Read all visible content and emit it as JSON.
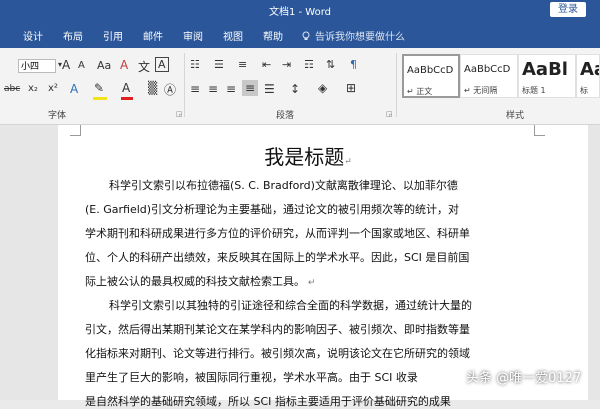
{
  "window": {
    "title": "文档1 - Word",
    "login": "登录"
  },
  "ribbon_tabs": [
    "设计",
    "布局",
    "引用",
    "邮件",
    "审阅",
    "视图",
    "帮助"
  ],
  "tell_me": "告诉我你想要做什么",
  "font": {
    "size": "小四",
    "grow": "A",
    "shrink": "A",
    "aa": "Aa",
    "clear": "A",
    "wen": "文",
    "box_a": "A"
  },
  "format_row": {
    "abc": "abc",
    "sub": "x₂",
    "sup": "x²",
    "effect": "A",
    "font_color": "A"
  },
  "groups": {
    "font": "字体",
    "paragraph": "段落",
    "styles": "样式"
  },
  "styles": [
    {
      "sample": "AaBbCcD",
      "name": "↵ 正文"
    },
    {
      "sample": "AaBbCcD",
      "name": "↵ 无间隔"
    },
    {
      "sample": "AaBl",
      "name": "标题 1"
    },
    {
      "sample": "Aa",
      "name": "标"
    }
  ],
  "document": {
    "title": "我是标题",
    "para1": [
      "科学引文索引以布拉德福(S. C. Bradford)文献离散律理论、以加菲尔德",
      "(E. Garfield)引文分析理论为主要基础，通过论文的被引用频次等的统计，对",
      "学术期刊和科研成果进行多方位的评价研究，从而评判一个国家或地区、科研单",
      "位、个人的科研产出绩效，来反映其在国际上的学术水平。因此，SCI 是目前国",
      "际上被公认的最具权威的科技文献检索工具。"
    ],
    "para2": [
      "科学引文索引以其独特的引证途径和综合全面的科学数据，通过统计大量的",
      "引文，然后得出某期刊某论文在某学科内的影响因子、被引频次、即时指数等量",
      "化指标来对期刊、论文等进行排行。被引频次高，说明该论文在它所研究的领域",
      "里产生了巨大的影响，被国际同行重视，学术水平高。由于 SCI 收录",
      "是自然科学的基础研究领域，所以 SCI 指标主要适用于评价基础研究的成果"
    ]
  },
  "watermark": "头条 @唯一爱0127"
}
